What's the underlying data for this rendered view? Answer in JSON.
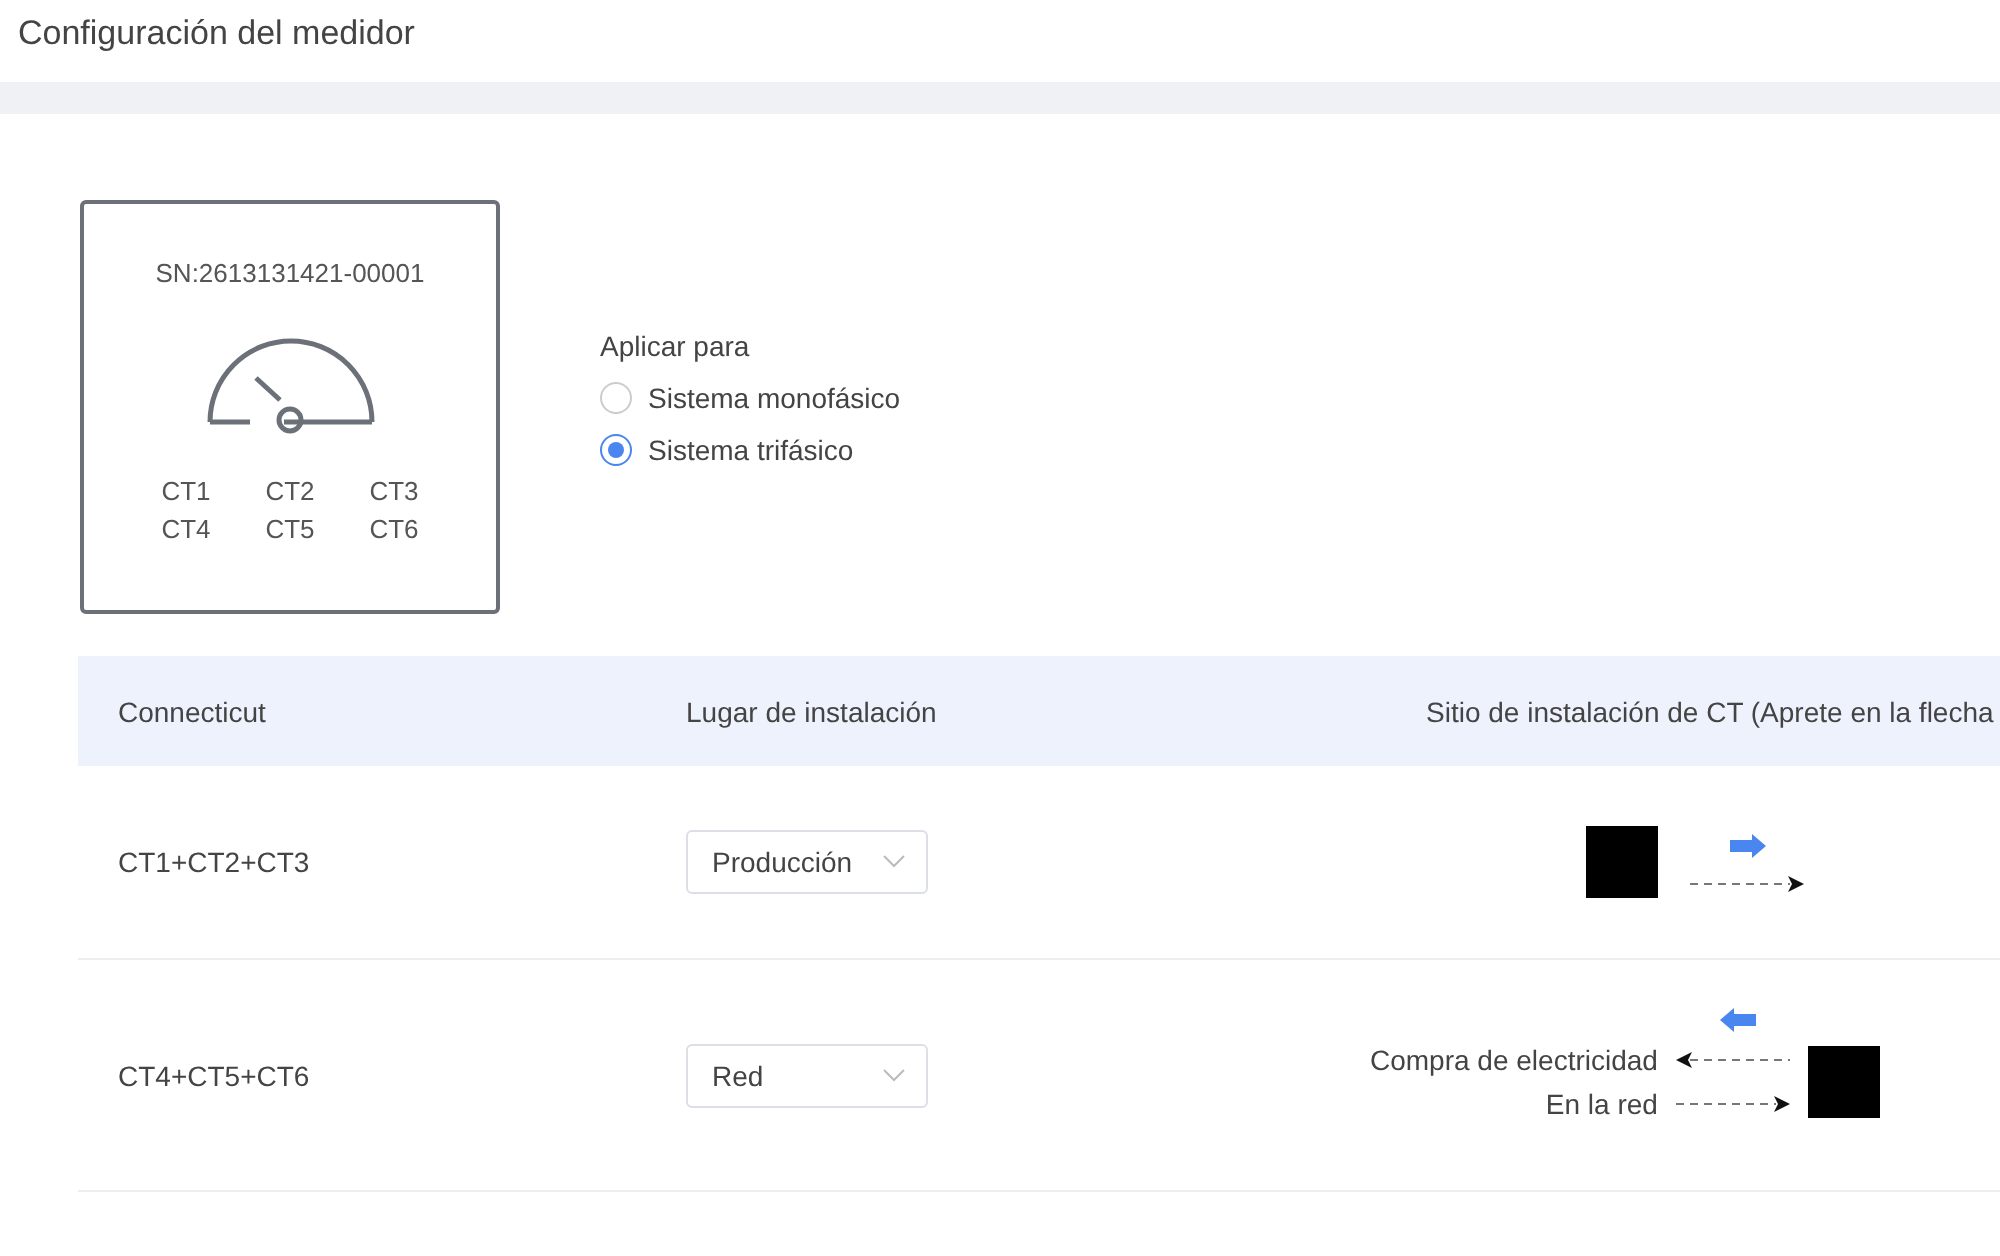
{
  "page": {
    "title": "Configuración del medidor"
  },
  "meter": {
    "serial": "SN:2613131421-00001",
    "ct_labels": [
      "CT1",
      "CT2",
      "CT3",
      "CT4",
      "CT5",
      "CT6"
    ]
  },
  "apply_for": {
    "label": "Aplicar para",
    "options": [
      {
        "label": "Sistema monofásico",
        "selected": false
      },
      {
        "label": "Sistema trifásico",
        "selected": true
      }
    ]
  },
  "table": {
    "columns": [
      "Connecticut",
      "Lugar de instalación",
      "Sitio de instalación de CT (Aprete en la flecha"
    ],
    "rows": [
      {
        "kind": "production",
        "name": "CT1+CT2+CT3",
        "location": "Producción"
      },
      {
        "kind": "grid",
        "name": "CT4+CT5+CT6",
        "location": "Red",
        "labels": [
          "Compra de electricidad",
          "En la red"
        ]
      }
    ]
  }
}
